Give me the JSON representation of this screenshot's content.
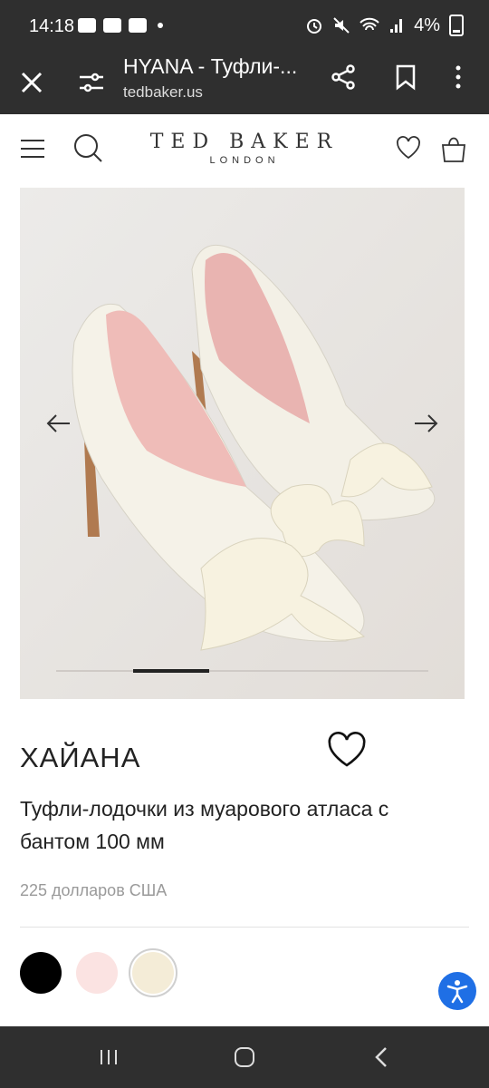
{
  "status_bar": {
    "time": "14:18",
    "battery": "4%",
    "icons": [
      "gallery-icon",
      "message-icon",
      "youtube-icon",
      "notification-dot",
      "alarm-icon",
      "mute-icon",
      "wifi-icon",
      "signal-icon",
      "battery-icon"
    ]
  },
  "browser": {
    "title": "HYANA - Туфли-...",
    "url": "tedbaker.us"
  },
  "site_header": {
    "brand_line1": "TED BAKER",
    "brand_line2": "LONDON"
  },
  "product": {
    "name": "ХАЙАНА",
    "description": "Туфли-лодочки из муарового атласа с бантом 100 мм",
    "price": "225 долларов США",
    "gallery": {
      "current_image": 2,
      "total_images": 5,
      "image_subject": "ivory moire satin pointed pumps with bow"
    },
    "swatches": [
      {
        "name": "black",
        "color": "#000000",
        "selected": false
      },
      {
        "name": "pale-pink",
        "color": "#fbe3e2",
        "selected": false
      },
      {
        "name": "ivory",
        "color": "#f4ecd7",
        "selected": true
      }
    ]
  },
  "colors": {
    "system_bar": "#2f2f2f",
    "accessibility_button": "#1f6fe5"
  }
}
